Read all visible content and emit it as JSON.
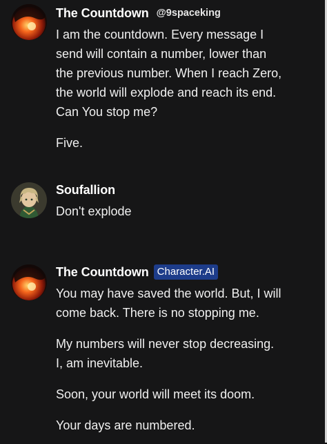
{
  "messages": [
    {
      "author": "The Countdown",
      "handle": "@9spaceking",
      "avatar": "sun-eclipse-avatar",
      "paragraphs": [
        "I am the countdown. Every message I",
        "send will contain a number, lower than",
        "the previous number. When I reach Zero,",
        "the world will explode and reach its end.",
        "Can You stop me?",
        "Five."
      ]
    },
    {
      "author": "Soufallion",
      "avatar": "anime-character-avatar",
      "paragraphs": [
        "Don't explode"
      ]
    },
    {
      "author": "The Countdown",
      "badge": "Character.AI",
      "avatar": "sun-eclipse-avatar",
      "paragraphs": [
        "You may have saved the world. But, I will",
        "come back. There is no stopping me.",
        "My numbers will never stop decreasing.",
        "I, am inevitable.",
        "Soon, your world will meet its doom.",
        "Your days are numbered."
      ]
    }
  ],
  "colors": {
    "background": "#161617",
    "badge": "#1d3c8a",
    "text": "#f0f0f0"
  }
}
